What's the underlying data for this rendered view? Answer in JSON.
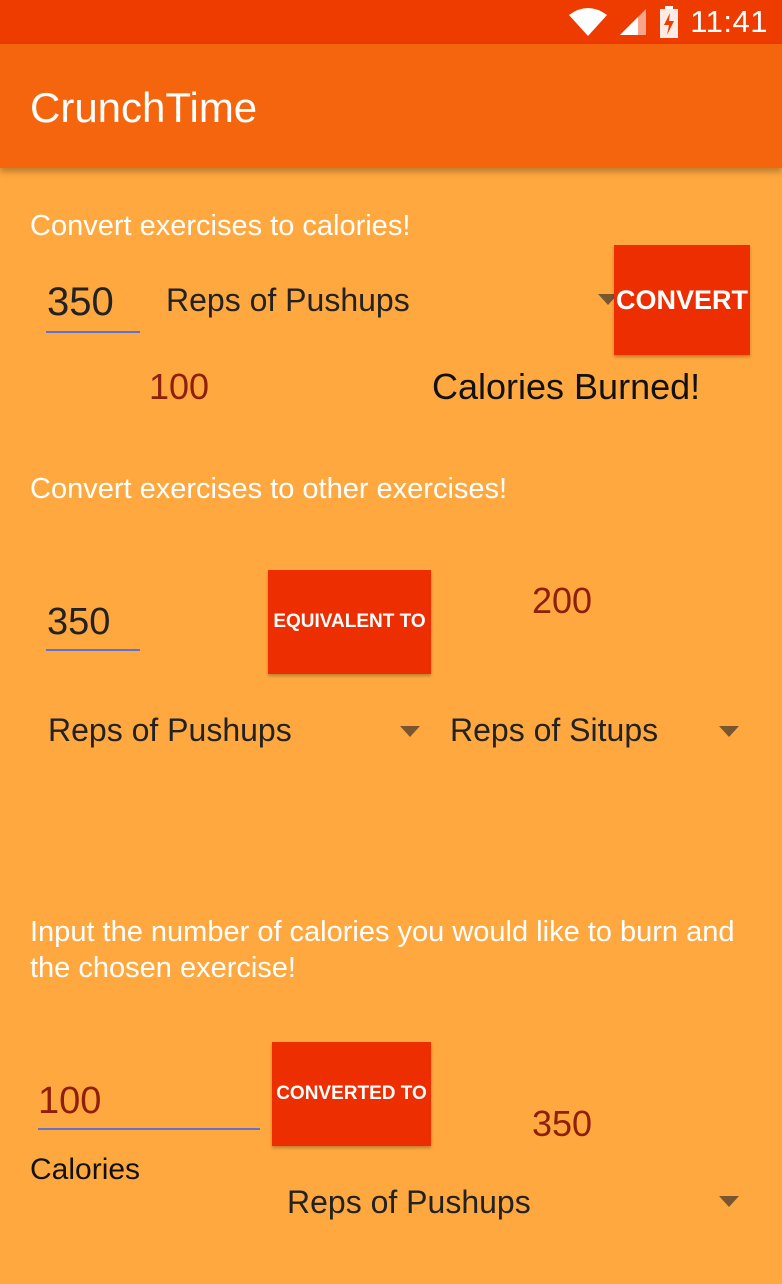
{
  "status_bar": {
    "time": "11:41",
    "icons": [
      "wifi-icon",
      "cell-signal-icon",
      "battery-charging-icon"
    ]
  },
  "app_bar": {
    "title": "CrunchTime"
  },
  "section_calories": {
    "title": "Convert exercises to calories!",
    "input_value": "350",
    "exercise_spinner": "Reps of Pushups",
    "button_label": "CONVERT",
    "result_value": "100",
    "result_label": "Calories Burned!"
  },
  "section_exercises": {
    "title": "Convert exercises to other exercises!",
    "input_value": "350",
    "button_label": "EQUIVALENT TO",
    "result_value": "200",
    "from_spinner": "Reps of Pushups",
    "to_spinner": "Reps of Situps"
  },
  "section_goal": {
    "title": "Input the number of calories you would like to burn and the chosen exercise!",
    "input_value": "100",
    "input_label": "Calories",
    "button_label": "CONVERTED TO",
    "result_value": "350",
    "exercise_spinner": "Reps of Pushups"
  },
  "colors": {
    "status_bar": "#EE3B00",
    "app_bar": "#F4650E",
    "background": "#FFA83F",
    "button": "#EC2E00",
    "result_text": "#8E1F0A",
    "input_underline": "#5C74CF"
  }
}
